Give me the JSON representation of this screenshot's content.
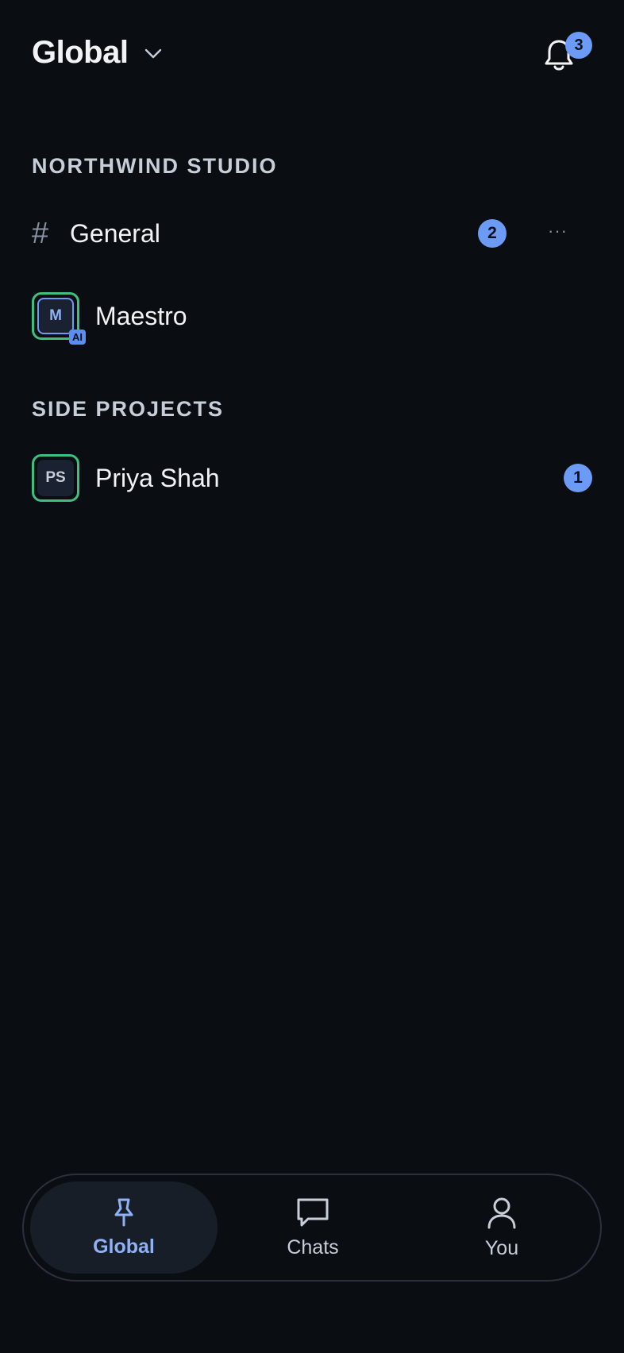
{
  "header": {
    "title": "Global",
    "notification_count": "3"
  },
  "sections": [
    {
      "title": "NORTHWIND STUDIO",
      "items": [
        {
          "type": "channel",
          "label": "General",
          "badge": "2",
          "more": "···"
        },
        {
          "type": "bot",
          "label": "Maestro",
          "avatar_initials": "M",
          "tag": "AI"
        }
      ]
    },
    {
      "title": "SIDE PROJECTS",
      "items": [
        {
          "type": "person",
          "label": "Priya Shah",
          "avatar_initials": "PS",
          "badge": "1"
        }
      ]
    }
  ],
  "bottom_nav": {
    "items": [
      {
        "label": "Global",
        "icon": "pin-icon",
        "active": true
      },
      {
        "label": "Chats",
        "icon": "chat-bubble-icon",
        "active": false
      },
      {
        "label": "You",
        "icon": "user-icon",
        "active": false
      }
    ]
  },
  "colors": {
    "background": "#0a0d12",
    "accent": "#6b9bf5",
    "online_ring": "#3fbf7f"
  }
}
